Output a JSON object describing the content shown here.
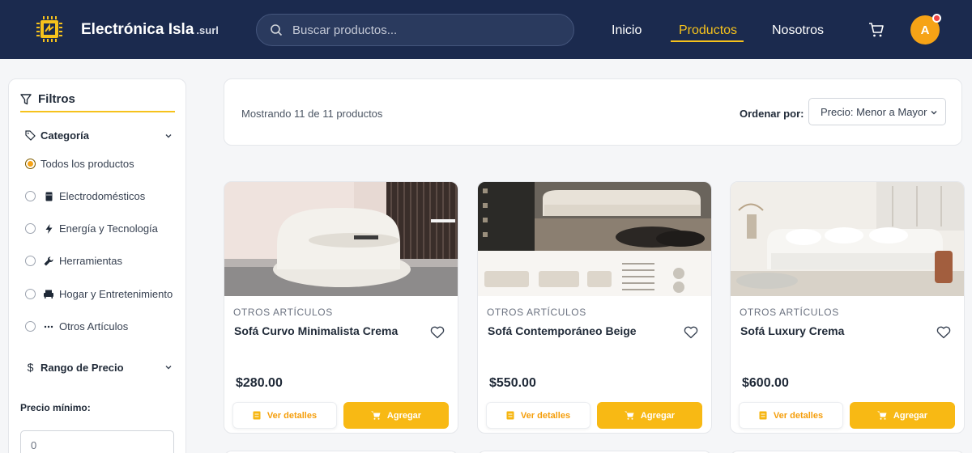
{
  "header": {
    "brand_name": "Electrónica Isla",
    "brand_suffix": ".surl",
    "search_placeholder": "Buscar productos...",
    "nav": [
      {
        "label": "Inicio"
      },
      {
        "label": "Productos"
      },
      {
        "label": "Nosotros"
      }
    ],
    "active_nav": "Productos",
    "avatar_initial": "A",
    "colors": {
      "bar": "#1b2a4e",
      "accent": "#f6c21c",
      "notification": "#ef4444"
    }
  },
  "sidebar": {
    "title": "Filtros",
    "category_heading": "Categoría",
    "categories": [
      {
        "label": "Todos los productos",
        "icon": "none",
        "selected": true
      },
      {
        "label": "Electrodomésticos",
        "icon": "appliance-icon",
        "selected": false
      },
      {
        "label": "Energía y Tecnología",
        "icon": "bolt-icon",
        "selected": false
      },
      {
        "label": "Herramientas",
        "icon": "wrench-icon",
        "selected": false
      },
      {
        "label": "Hogar y Entretenimiento",
        "icon": "couch-icon",
        "selected": false
      },
      {
        "label": "Otros Artículos",
        "icon": "ellipsis-icon",
        "selected": false
      }
    ],
    "price_heading": "Rango de Precio",
    "price_min_label": "Precio mínimo:",
    "price_min_value": "0"
  },
  "toolbar": {
    "showing_text": "Mostrando 11 de 11 productos",
    "sort_label": "Ordenar por:",
    "sort_value": "Precio: Menor a Mayor"
  },
  "products": [
    {
      "category": "OTROS ARTÍCULOS",
      "name": "Sofá Curvo Minimalista Crema",
      "price": "$280.00",
      "details_label": "Ver detalles",
      "add_label": "Agregar"
    },
    {
      "category": "OTROS ARTÍCULOS",
      "name": "Sofá Contemporáneo Beige",
      "price": "$550.00",
      "details_label": "Ver detalles",
      "add_label": "Agregar"
    },
    {
      "category": "OTROS ARTÍCULOS",
      "name": "Sofá Luxury Crema",
      "price": "$600.00",
      "details_label": "Ver detalles",
      "add_label": "Agregar"
    }
  ]
}
